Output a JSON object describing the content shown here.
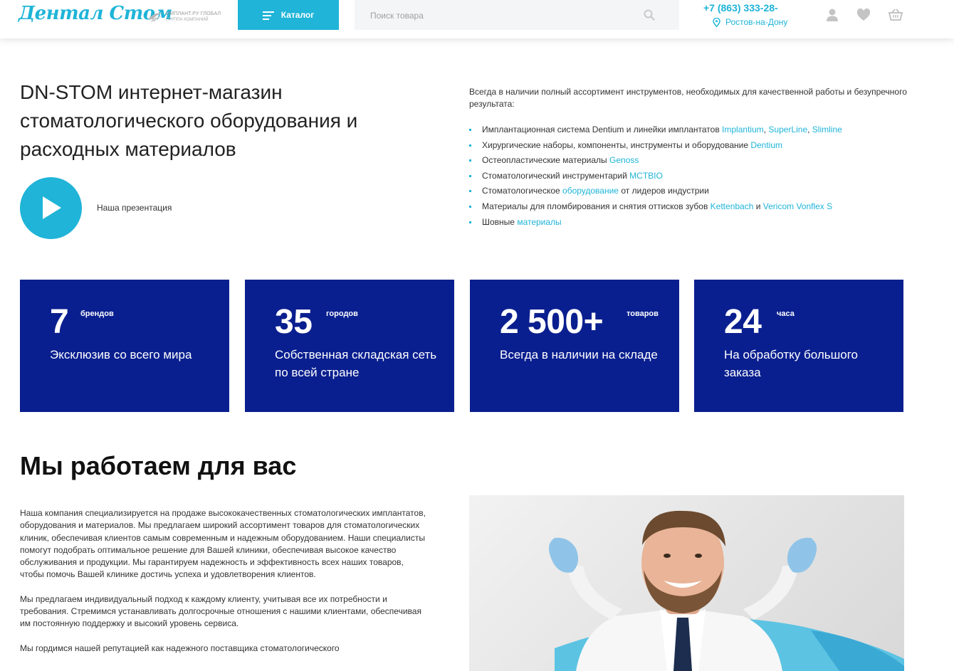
{
  "header": {
    "logo_text": "Дентал Стом",
    "partner_line1": "ИМПЛАНТ.РУ ГЛОБАЛ",
    "partner_line2": "ГРУППА КОМПАНИЙ",
    "catalog_label": "Каталог",
    "search_placeholder": "Поиск товара",
    "phone": "+7 (863) 333-28-",
    "city": "Ростов-на-Дону",
    "accent_color": "#1fb4d8"
  },
  "hero": {
    "title": "DN-STOM интернет-магазин стоматологического оборудования и расходных материалов",
    "presentation_label": "Наша презентация",
    "intro": "Всегда в наличии полный ассортимент инструментов, необходимых для качественной работы и безупречного результата:",
    "features": [
      {
        "text": "Имплантационная система Dentium и линейки имплантатов ",
        "links": [
          "Implantium",
          "SuperLine",
          "Slimline"
        ]
      },
      {
        "text": "Хирургические наборы, компоненты, инструменты и оборудование ",
        "links": [
          "Dentium"
        ]
      },
      {
        "text": "Остеопластические материалы ",
        "links": [
          "Genoss"
        ]
      },
      {
        "text": "Стоматологический инструментарий ",
        "links": [
          "MCTBIO"
        ]
      },
      {
        "text_before": "Стоматологическое ",
        "link": "оборудование",
        "text_after": " от лидеров индустрии"
      },
      {
        "text": "Материалы для пломбирования и снятия оттисков зубов ",
        "link1": "Kettenbach",
        "mid": " и ",
        "link2": "Vericom Vonflex S"
      },
      {
        "text": "Шовные ",
        "links": [
          "материалы"
        ]
      }
    ]
  },
  "stats": [
    {
      "number": "7",
      "unit": "брендов",
      "desc": "Эксклюзив со всего мира"
    },
    {
      "number": "35",
      "unit": "городов",
      "desc": "Собственная складская сеть по всей стране"
    },
    {
      "number": "2 500+",
      "unit": "товаров",
      "desc": "Всегда в наличии на складе"
    },
    {
      "number": "24",
      "unit": "часа",
      "desc": "На обработку большого заказа"
    }
  ],
  "stat_color": "#0a1f8f",
  "about": {
    "title": "Мы работаем для вас",
    "p1": "Наша компания специализируется на продаже высококачественных стоматологических имплантатов, оборудования и материалов. Мы предлагаем широкий ассортимент товаров для стоматологических клиник, обеспечивая клиентов самым современным и надежным оборудованием. Наши специалисты помогут подобрать оптимальное решение для Вашей клиники, обеспечивая высокое качество обслуживания и продукции. Мы гарантируем надежность и эффективность всех наших товаров, чтобы помочь Вашей клинике достичь успеха и удовлетворения клиентов.",
    "p2": "Мы предлагаем индивидуальный подход к каждому клиенту, учитывая все их потребности и требования. Стремимся устанавливать долгосрочные отношения с нашими клиентами, обеспечивая им постоянную поддержку и высокий уровень сервиса.",
    "p3": "Мы гордимся нашей репутацией как надежного поставщика стоматологического"
  }
}
